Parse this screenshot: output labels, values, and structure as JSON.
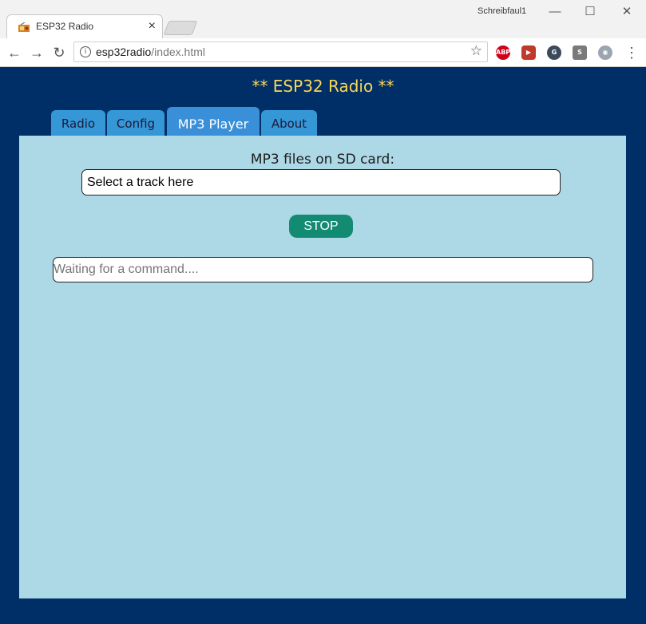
{
  "browser": {
    "tab_title": "ESP32 Radio",
    "tab_close": "×",
    "profile_name": "Schreibfaul1",
    "window_controls": {
      "minimize": "—",
      "maximize": "☐",
      "close": "✕"
    },
    "nav": {
      "back": "←",
      "forward": "→",
      "reload": "↻"
    },
    "address": {
      "host": "esp32radio",
      "path": "/index.html"
    },
    "info_icon": "i",
    "star": "☆",
    "extensions": [
      {
        "name": "adblock-plus-icon",
        "label": "ABP",
        "color": "#d0021b"
      },
      {
        "name": "video-download-icon",
        "label": "▶",
        "color": "#c0392b"
      },
      {
        "name": "ghostery-icon",
        "label": "G",
        "color": "#3b4a5a"
      },
      {
        "name": "stylus-icon",
        "label": "S",
        "color": "#7a7a7a"
      },
      {
        "name": "privacy-icon",
        "label": "◉",
        "color": "#9aa5b1"
      }
    ],
    "menu": "⋮"
  },
  "page": {
    "title": "** ESP32 Radio **",
    "tabs": [
      {
        "label": "Radio",
        "active": false
      },
      {
        "label": "Config",
        "active": false
      },
      {
        "label": "MP3 Player",
        "active": true
      },
      {
        "label": "About",
        "active": false
      }
    ],
    "mp3_label": "MP3 files on SD card:",
    "track_select": {
      "value": "Select a track here"
    },
    "stop_label": "STOP",
    "command_field": {
      "placeholder": "Waiting for a command...."
    }
  },
  "colors": {
    "page_background": "#002f67",
    "title": "#fbd75a",
    "tab": "#3597d6",
    "panel": "#add8e6",
    "stop_button": "#138a72"
  }
}
